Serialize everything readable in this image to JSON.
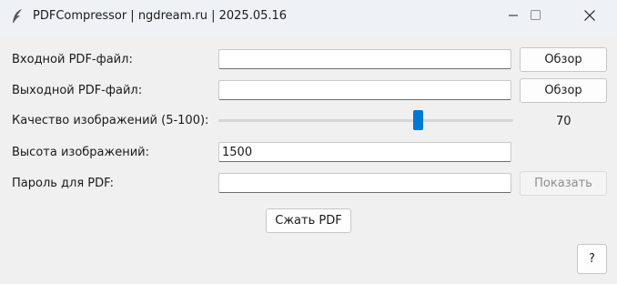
{
  "window": {
    "title": "PDFCompressor | ngdream.ru | 2025.05.16",
    "app_icon": "feather-icon",
    "controls": [
      "minimize-icon",
      "maximize-icon",
      "close-icon"
    ]
  },
  "form": {
    "input_label": "Входной PDF-файл:",
    "input_value": "",
    "output_label": "Выходной PDF-файл:",
    "output_value": "",
    "browse_label": "Обзор",
    "quality_label": "Качество изображений (5-100):",
    "quality": {
      "min": 5,
      "max": 100,
      "value": 70,
      "display": "70"
    },
    "height_label": "Высота изображений:",
    "height_value": "1500",
    "password_label": "Пароль для PDF:",
    "password_value": "",
    "show_label": "Показать"
  },
  "actions": {
    "compress_label": "Сжать PDF",
    "help_label": "?"
  },
  "colors": {
    "accent": "#0078d4",
    "window_bg": "#f0f0f0",
    "titlebar_bg": "#eef1f6"
  }
}
